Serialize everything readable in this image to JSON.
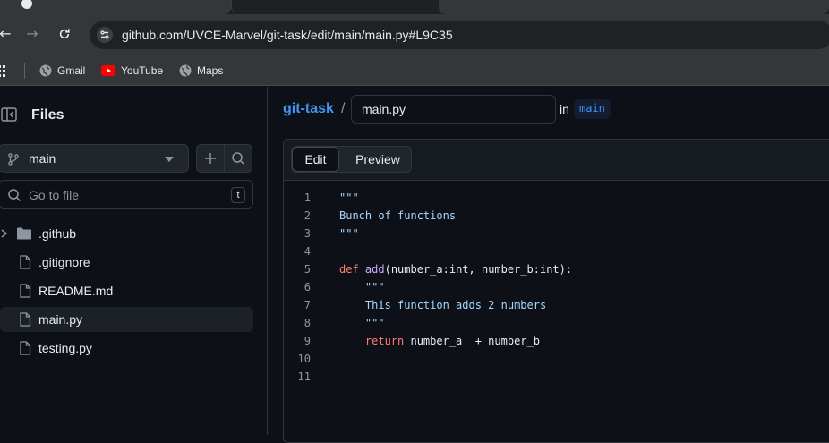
{
  "browser": {
    "url": "github.com/UVCE-Marvel/git-task/edit/main/main.py#L9C35",
    "bookmarks": [
      "Gmail",
      "YouTube",
      "Maps"
    ]
  },
  "sidebar": {
    "title": "Files",
    "branch": "main",
    "search_placeholder": "Go to file",
    "search_shortcut": "t",
    "tree": [
      {
        "label": ".github",
        "type": "folder"
      },
      {
        "label": ".gitignore",
        "type": "file"
      },
      {
        "label": "README.md",
        "type": "file"
      },
      {
        "label": "main.py",
        "type": "file",
        "selected": true
      },
      {
        "label": "testing.py",
        "type": "file"
      }
    ]
  },
  "main": {
    "repo": "git-task",
    "separator": "/",
    "filename": "main.py",
    "in_label": "in",
    "branch": "main",
    "tabs": {
      "edit": "Edit",
      "preview": "Preview"
    }
  },
  "code": {
    "line_numbers": [
      "1",
      "2",
      "3",
      "4",
      "5",
      "6",
      "7",
      "8",
      "9",
      "10",
      "11"
    ],
    "l1": "\"\"\"",
    "l2": "Bunch of functions",
    "l3": "\"\"\"",
    "l5_kw": "def ",
    "l5_fn": "add",
    "l5_rest": "(number_a:int, number_b:int):",
    "l6": "    \"\"\"",
    "l7": "    This function adds 2 numbers",
    "l8": "    \"\"\"",
    "l9_kw": "    return",
    "l9_rest": " number_a  + number_b"
  }
}
